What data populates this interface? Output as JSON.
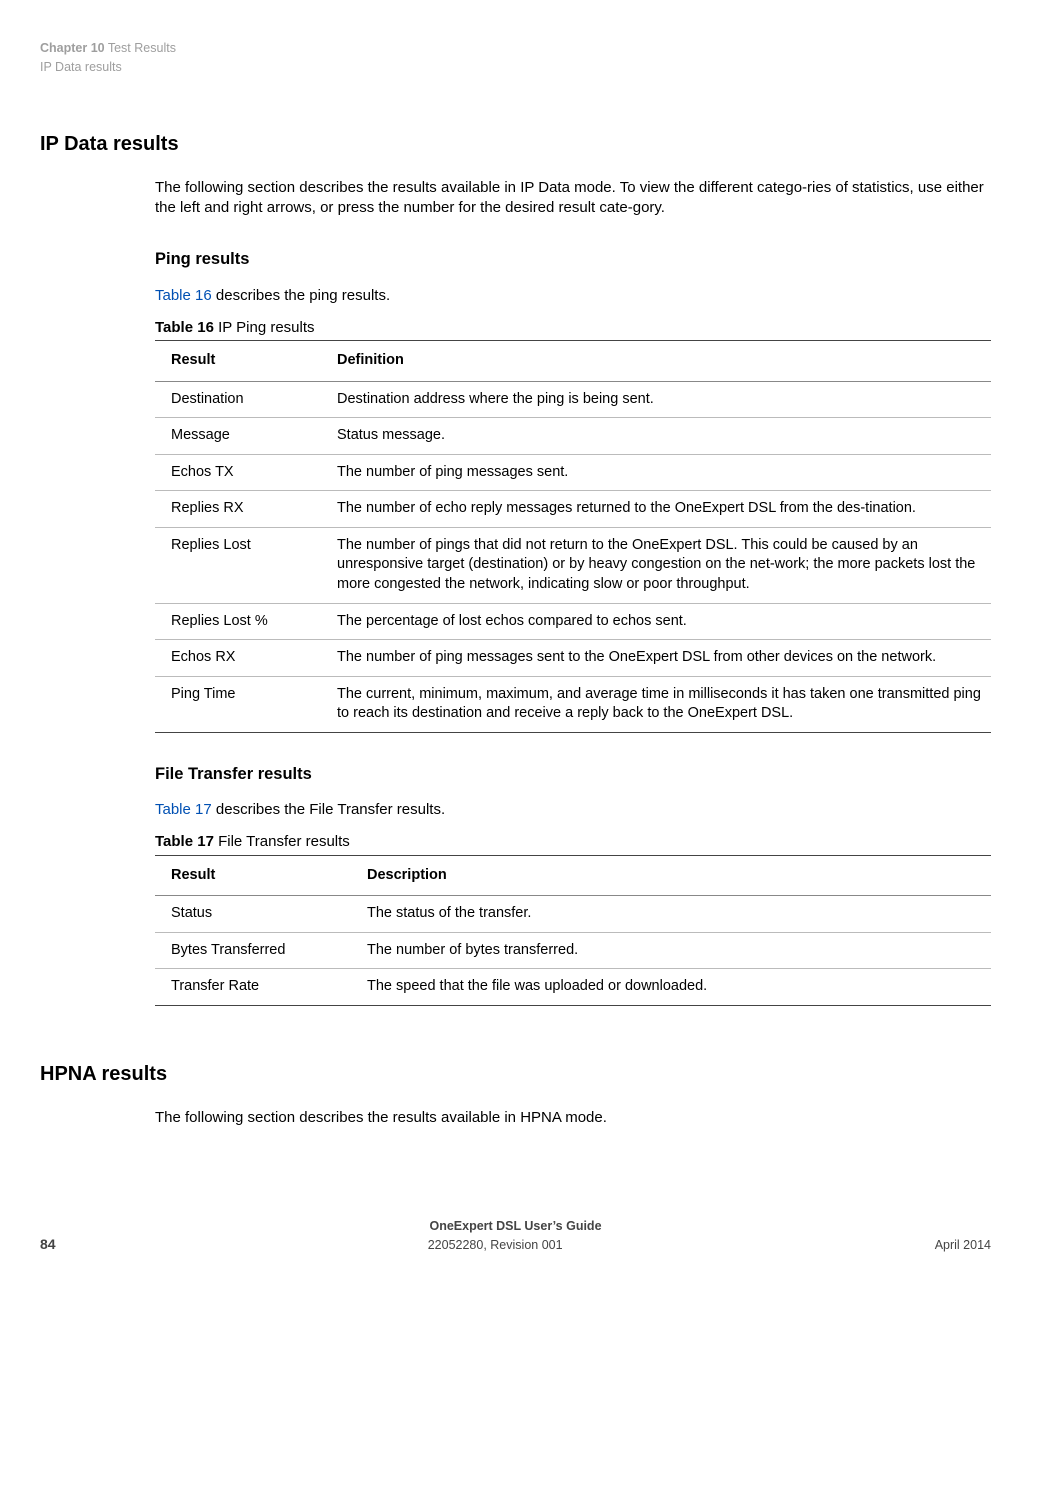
{
  "header": {
    "chapter_label": "Chapter 10",
    "chapter_title": "Test Results",
    "section_title": "IP Data results"
  },
  "sec1": {
    "heading": "IP Data results",
    "intro": "The following section describes the results available in IP Data mode. To view the different catego-ries of statistics, use either the left and right arrows, or press the number for the desired result cate-gory."
  },
  "ping": {
    "heading": "Ping results",
    "lead_link": "Table 16",
    "lead_rest": " describes the ping results.",
    "caption_label": "Table 16",
    "caption_text": "  IP Ping results",
    "cols": {
      "c1": "Result",
      "c2": "Definition"
    },
    "rows": [
      {
        "r": "Destination",
        "d": "Destination address where the ping is being sent."
      },
      {
        "r": "Message",
        "d": "Status message."
      },
      {
        "r": "Echos TX",
        "d": "The number of ping messages sent."
      },
      {
        "r": "Replies RX",
        "d": "The number of echo reply messages returned to the OneExpert DSL from the des-tination."
      },
      {
        "r": "Replies Lost",
        "d": "The number of pings that did not return to the OneExpert DSL. This could be caused by an unresponsive target (destination) or by heavy congestion on the net-work; the more packets lost the more congested the network, indicating slow or poor throughput."
      },
      {
        "r": "Replies Lost %",
        "d": "The percentage of lost echos compared to echos sent."
      },
      {
        "r": "Echos RX",
        "d": "The number of ping messages sent to the OneExpert DSL from other devices on the network."
      },
      {
        "r": "Ping Time",
        "d": "The current, minimum, maximum, and average time in milliseconds it has taken one transmitted ping to reach its destination and receive a reply back to the OneExpert DSL."
      }
    ]
  },
  "ft": {
    "heading": "File Transfer results",
    "lead_link": "Table 17",
    "lead_rest": " describes the File Transfer results.",
    "caption_label": "Table 17",
    "caption_text": "   File Transfer results",
    "cols": {
      "c1": "Result",
      "c2": "Description"
    },
    "rows": [
      {
        "r": "Status",
        "d": "The status of the transfer."
      },
      {
        "r": "Bytes Transferred",
        "d": "The number of bytes transferred."
      },
      {
        "r": "Transfer Rate",
        "d": "The speed that the file was uploaded or downloaded."
      }
    ]
  },
  "hpna": {
    "heading": "HPNA results",
    "intro": "The following section describes the results available in HPNA mode."
  },
  "footer": {
    "guide": "OneExpert DSL User’s Guide",
    "docnum": "22052280, Revision 001",
    "date": "April 2014",
    "page": "84"
  }
}
